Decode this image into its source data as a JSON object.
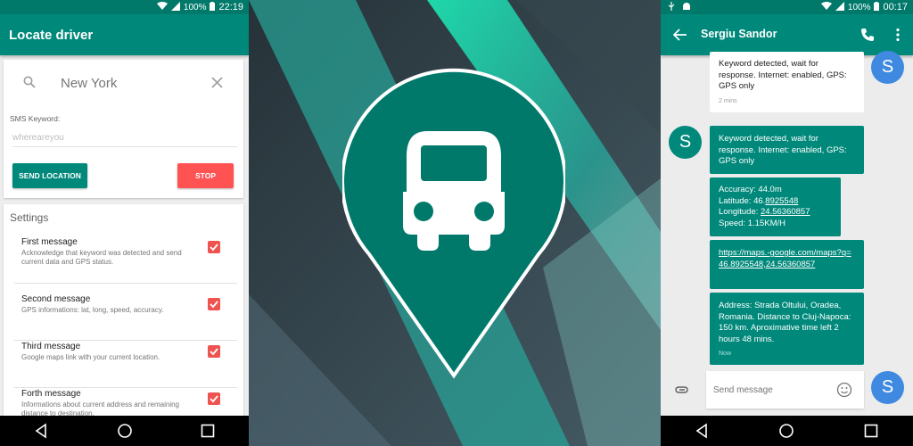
{
  "left_phone": {
    "status": {
      "battery": "100%",
      "time": "22:19"
    },
    "app_title": "Locate driver",
    "search": {
      "value": "New York"
    },
    "sms_keyword": {
      "label": "SMS Keyword:",
      "placeholder": "whereareyou"
    },
    "buttons": {
      "send": "SEND LOCATION",
      "stop": "STOP"
    },
    "settings": {
      "title": "Settings",
      "items": [
        {
          "title": "First message",
          "desc": "Acknowledge that keyword was detected and send current data and GPS status.",
          "checked": true
        },
        {
          "title": "Second message",
          "desc": "GPS informations: lat, long, speed, accuracy.",
          "checked": true
        },
        {
          "title": "Third message",
          "desc": "Google maps link with your current location.",
          "checked": true
        },
        {
          "title": "Forth message",
          "desc": "Informations about current address and remaining distance to destination.",
          "checked": true
        }
      ]
    }
  },
  "center": {
    "icon": "map-pin-car-icon",
    "colors": {
      "pin": "#00796b",
      "stripe": "#1de9b6",
      "bg": "#37474f"
    }
  },
  "right_phone": {
    "status": {
      "battery": "100%",
      "time": "00:17"
    },
    "contact": "Sergiu Sandor",
    "avatar_letter": "S",
    "messages": [
      {
        "direction": "out",
        "text": "Keyword detected, wait for response. Internet: enabled, GPS: GPS only",
        "time": "2 mins"
      },
      {
        "direction": "in",
        "text": "Keyword detected, wait for response. Internet: enabled, GPS: GPS only"
      },
      {
        "direction": "in",
        "lines": {
          "accuracy": "Accuracy: 44.0m",
          "lat_label": "Latitude: 46.",
          "lat_link": "8925548",
          "lon_label": "Longitude: ",
          "lon_link": "24.56360857",
          "speed": "Speed: 1.15KM/H"
        }
      },
      {
        "direction": "in",
        "link": "https://maps.-google.com/maps?q=46.8925548,24.56360857"
      },
      {
        "direction": "in",
        "text": "Address: Strada Oltului, Oradea, Romania. Distance to Cluj-Napoca: 150 km. Aproximative time left 2 hours 48 mins.",
        "time": "Now"
      }
    ],
    "compose_placeholder": "Send message"
  },
  "colors": {
    "primary": "#00897b",
    "primary_dark": "#00796b",
    "accent": "#ff5252",
    "avatar_blue": "#3f8ae0"
  }
}
